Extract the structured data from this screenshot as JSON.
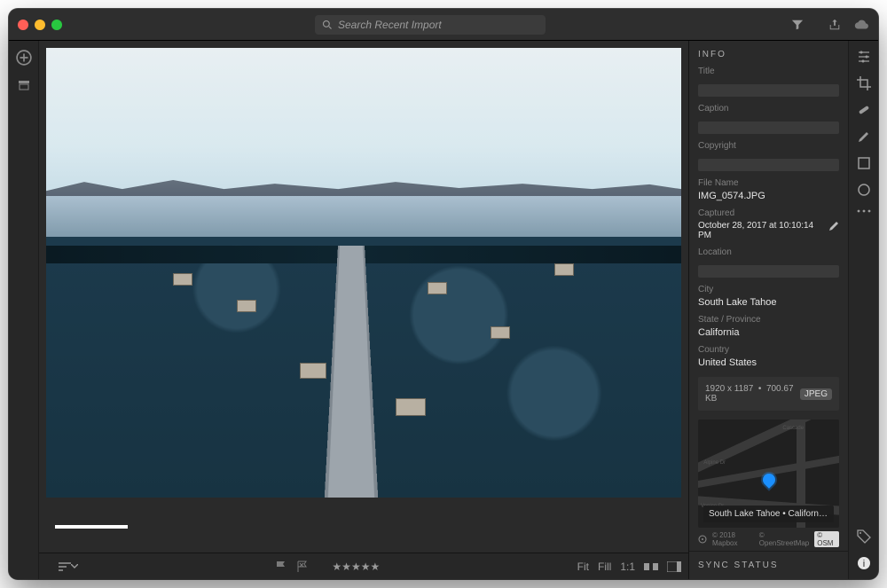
{
  "titlebar": {
    "search_placeholder": "Search Recent Import"
  },
  "panel": {
    "header": "INFO",
    "title_label": "Title",
    "caption_label": "Caption",
    "copyright_label": "Copyright",
    "filename_label": "File Name",
    "filename": "IMG_0574.JPG",
    "captured_label": "Captured",
    "captured": "October 28, 2017 at 10:10:14 PM",
    "location_label": "Location",
    "city_label": "City",
    "city": "South Lake Tahoe",
    "state_label": "State / Province",
    "state": "California",
    "country_label": "Country",
    "country": "United States",
    "dimensions": "1920 x 1187",
    "filesize": "700.67 KB",
    "format_badge": "JPEG",
    "map_caption": "South Lake Tahoe • California • U...",
    "map_attr1": "© 2018 Mapbox",
    "map_attr2": "© OpenStreetMap",
    "map_osm": "© OSM",
    "map_streets": [
      "Cascade",
      "Alpine Dr",
      "Venice Dr"
    ]
  },
  "bottombar": {
    "fit": "Fit",
    "fill": "Fill",
    "oneone": "1:1"
  },
  "sync_header": "SYNC STATUS",
  "colors": {
    "close": "#ff5f57",
    "min": "#febc2e",
    "max": "#28c840"
  }
}
